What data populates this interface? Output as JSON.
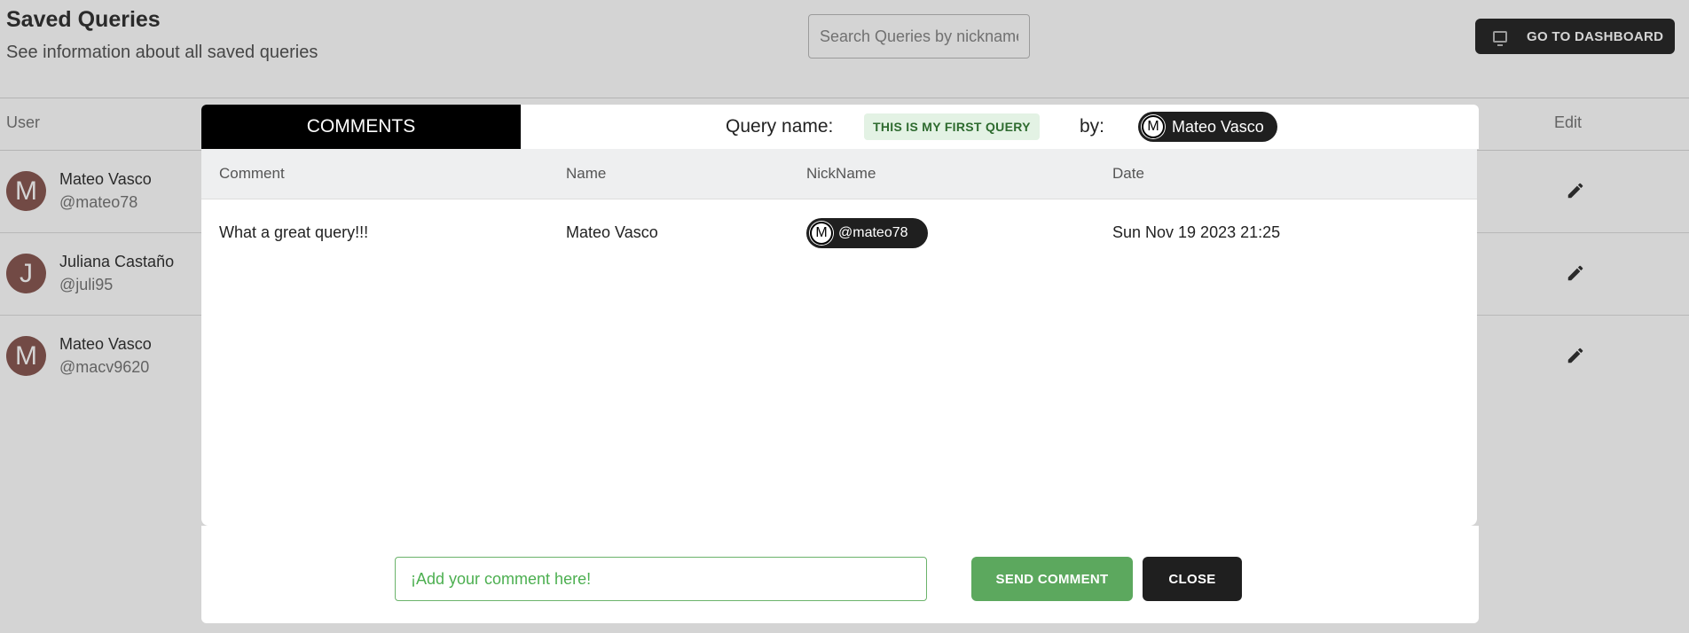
{
  "page": {
    "title": "Saved Queries",
    "subtitle": "See information about all saved queries",
    "search_placeholder": "Search Queries by nickname",
    "dashboard_button": "GO TO DASHBOARD",
    "columns": {
      "user": "User",
      "edit": "Edit"
    },
    "users": [
      {
        "initial": "M",
        "name": "Mateo Vasco",
        "nick": "@mateo78"
      },
      {
        "initial": "J",
        "name": "Juliana Castaño",
        "nick": "@juli95"
      },
      {
        "initial": "M",
        "name": "Mateo Vasco",
        "nick": "@macv9620"
      }
    ]
  },
  "modal": {
    "tab": "COMMENTS",
    "query_name_label": "Query name:",
    "query_name": "THIS IS MY FIRST QUERY",
    "by_label": "by:",
    "author": {
      "initial": "M",
      "name": "Mateo Vasco"
    },
    "columns": [
      "Comment",
      "Name",
      "NickName",
      "Date"
    ],
    "rows": [
      {
        "comment": "What a great query!!!",
        "name": "Mateo Vasco",
        "nick_initial": "M",
        "nick": "@mateo78",
        "date": "Sun Nov 19 2023 21:25"
      }
    ],
    "input_placeholder": "¡Add your comment here!",
    "send_button": "SEND COMMENT",
    "close_button": "CLOSE"
  },
  "colors": {
    "accent_green": "#5ca85e",
    "dark": "#1f1f1f",
    "chip_green_bg": "#e3f2e4"
  }
}
